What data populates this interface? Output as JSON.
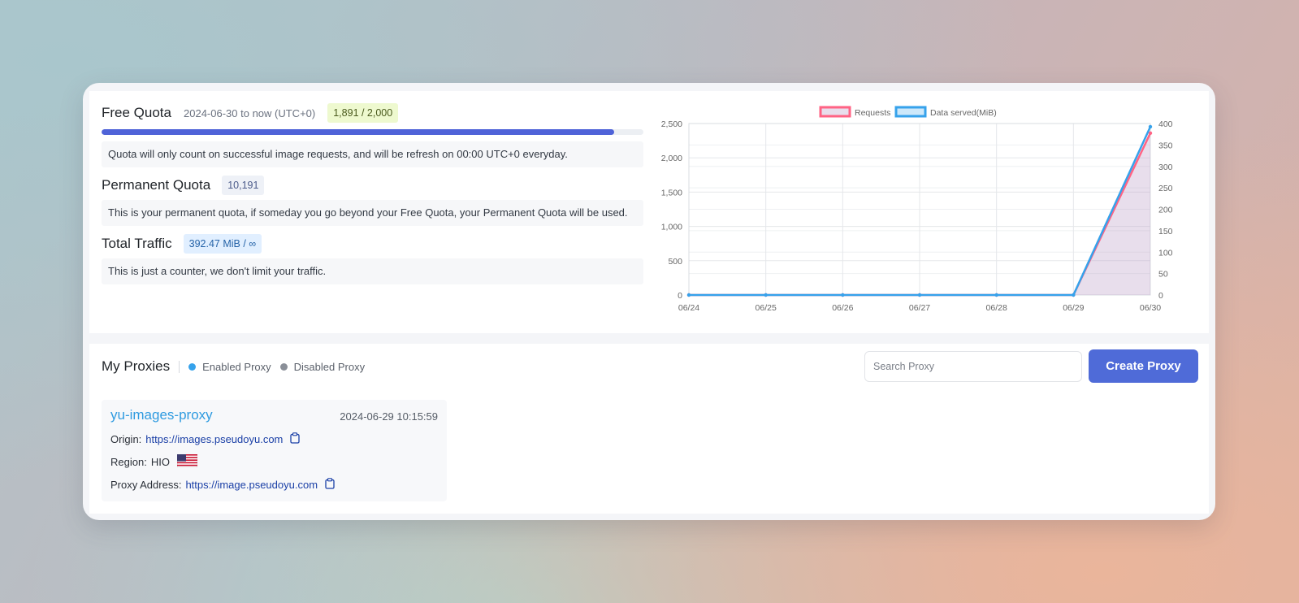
{
  "free_quota": {
    "title": "Free Quota",
    "period": "2024-06-30 to now (UTC+0)",
    "usage_badge": "1,891 / 2,000",
    "progress": 0.9455,
    "note": "Quota will only count on successful image requests, and will be refresh on 00:00 UTC+0 everyday."
  },
  "permanent_quota": {
    "title": "Permanent Quota",
    "value": "10,191",
    "note": "This is your permanent quota, if someday you go beyond your Free Quota, your Permanent Quota will be used."
  },
  "total_traffic": {
    "title": "Total Traffic",
    "value": "392.47 MiB / ∞",
    "note": "This is just a counter, we don't limit your traffic."
  },
  "chart_data": {
    "type": "line",
    "categories": [
      "06/24",
      "06/25",
      "06/26",
      "06/27",
      "06/28",
      "06/29",
      "06/30"
    ],
    "series": [
      {
        "name": "Requests",
        "axis": "left",
        "color": "#ff6384",
        "fill": "rgba(190,160,200,0.35)",
        "values": [
          0,
          0,
          0,
          0,
          0,
          0,
          2360
        ]
      },
      {
        "name": "Data served(MiB)",
        "axis": "right",
        "color": "#36a2eb",
        "values": [
          0,
          0,
          0,
          0,
          0,
          0,
          392.47
        ]
      }
    ],
    "y_left": {
      "ticks": [
        "0",
        "500",
        "1,000",
        "1,500",
        "2,000",
        "2,500"
      ],
      "min": 0,
      "max": 2500
    },
    "y_right": {
      "ticks": [
        "0",
        "50",
        "100",
        "150",
        "200",
        "250",
        "300",
        "350",
        "400"
      ],
      "min": 0,
      "max": 400
    },
    "grid": true,
    "legend_position": "top"
  },
  "proxies": {
    "title": "My Proxies",
    "legend_enabled": "Enabled Proxy",
    "legend_disabled": "Disabled Proxy",
    "enabled_color": "#36a2eb",
    "disabled_color": "#8a8f98",
    "search_placeholder": "Search Proxy",
    "create_label": "Create Proxy",
    "items": [
      {
        "name": "yu-images-proxy",
        "created": "2024-06-29 10:15:59",
        "origin_label": "Origin:",
        "origin": "https://images.pseudoyu.com",
        "region_label": "Region:",
        "region": "HIO",
        "address_label": "Proxy Address:",
        "address": "https://image.pseudoyu.com",
        "clipboard_icon": "clipboard-icon",
        "flag_icon": "us-flag-icon"
      }
    ]
  }
}
